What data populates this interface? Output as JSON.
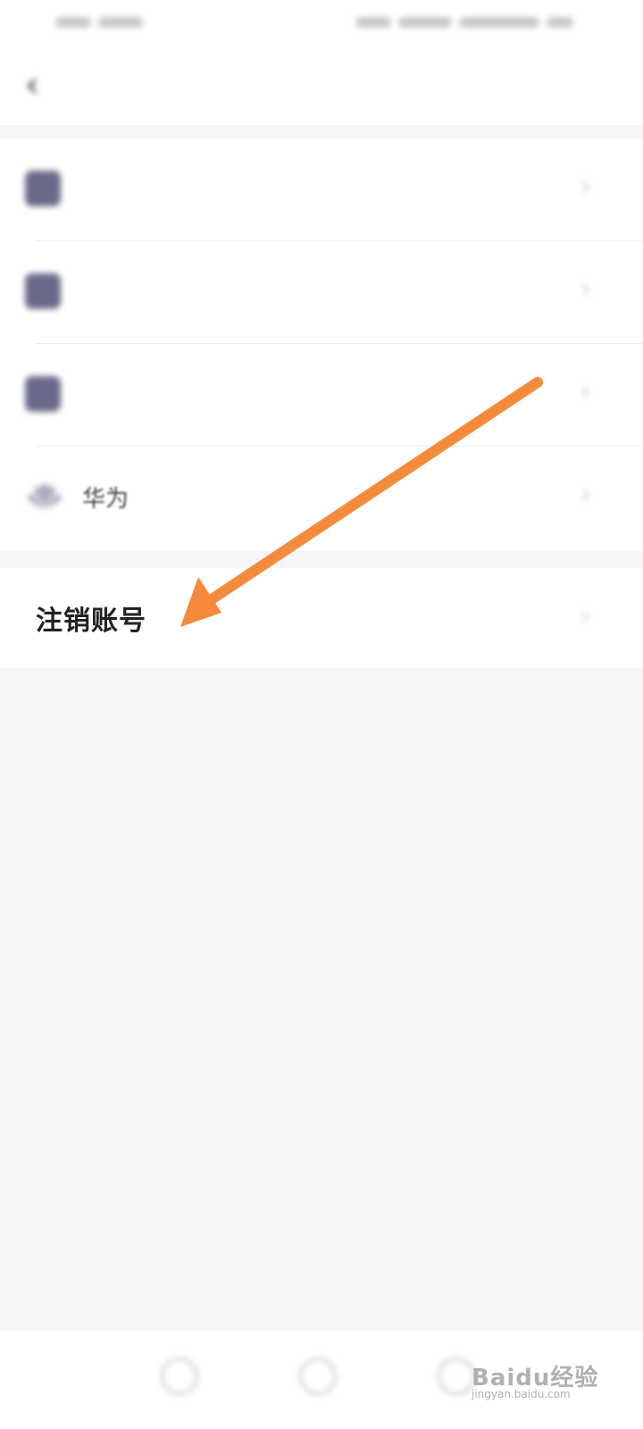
{
  "status_bar": {},
  "header": {
    "title": "",
    "back_icon": "chevron-left-icon"
  },
  "settings_rows": [
    {
      "name": "profile",
      "label": "",
      "status": "",
      "icon": "user-icon"
    },
    {
      "name": "qq",
      "label": "",
      "status": "",
      "icon": "qq-icon"
    },
    {
      "name": "wechat",
      "label": "",
      "status": "",
      "icon": "wechat-icon"
    },
    {
      "name": "huawei",
      "label": "华为",
      "status": "",
      "icon": "huawei-logo-icon"
    }
  ],
  "cancel_account": {
    "label": "注销账号"
  },
  "annotation": {
    "arrow_color": "#F58A3B"
  },
  "colors": {
    "accent_status": "#F26A3B",
    "background": "#F6F6F8"
  },
  "watermark": {
    "text": "Baidu经验",
    "subtext": "jingyan.baidu.com"
  }
}
